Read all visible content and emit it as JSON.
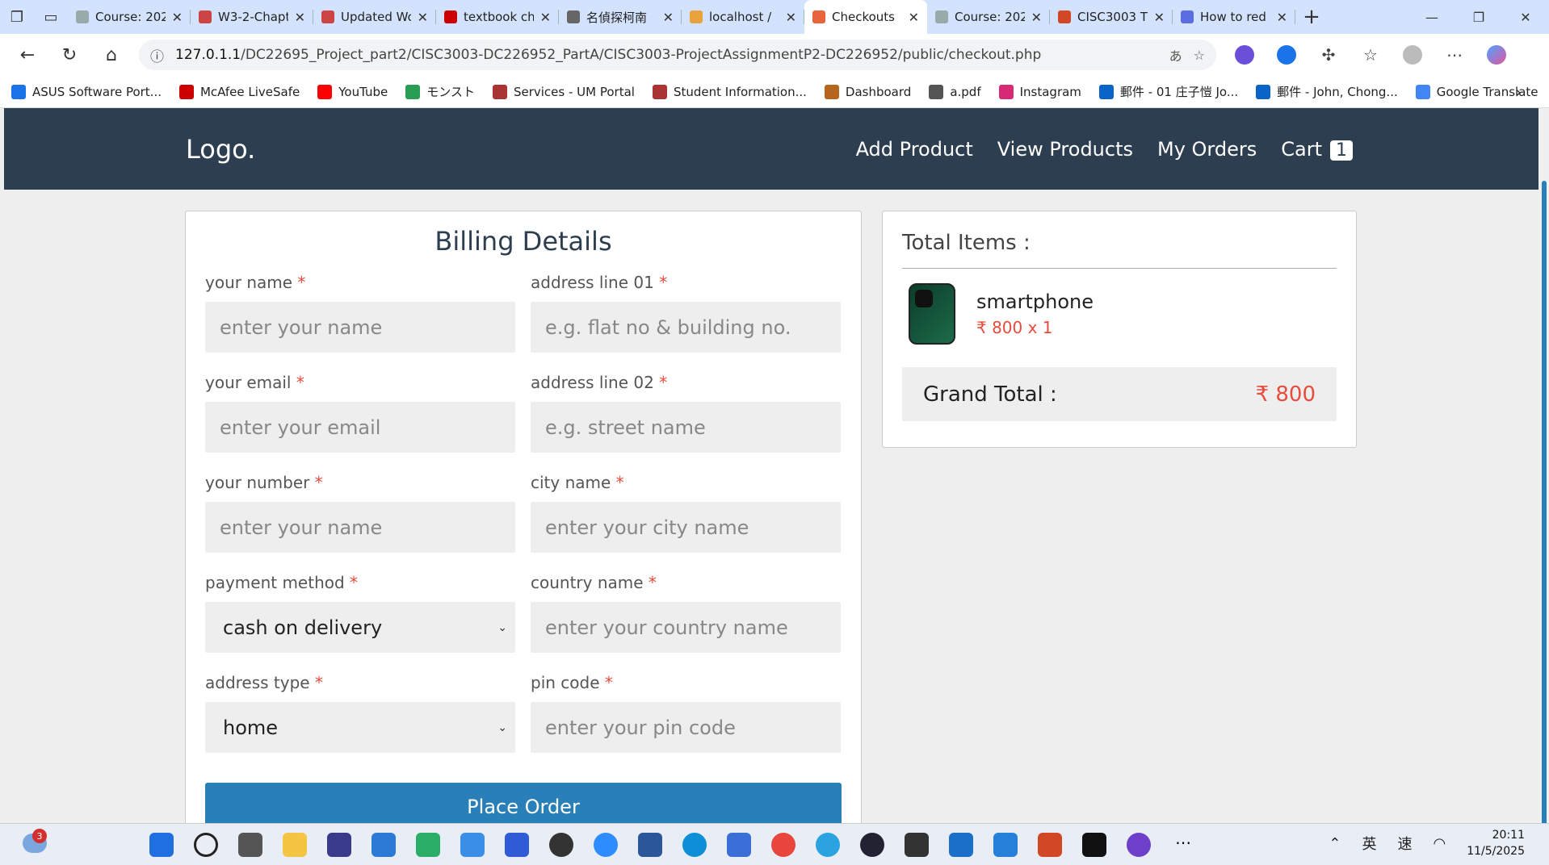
{
  "browser": {
    "tabs": [
      {
        "title": "Course: 2025",
        "color": "#9aa"
      },
      {
        "title": "W3-2-Chapter",
        "color": "#c44"
      },
      {
        "title": "Updated Wo",
        "color": "#c44"
      },
      {
        "title": "textbook ch",
        "color": "#c00"
      },
      {
        "title": "名偵探柯南",
        "color": "#666"
      },
      {
        "title": "localhost /",
        "color": "#e8a33d"
      },
      {
        "title": "Checkouts",
        "color": "#e8643d",
        "active": true
      },
      {
        "title": "Course: 2025",
        "color": "#9aa"
      },
      {
        "title": "CISC3003 T",
        "color": "#d24726"
      },
      {
        "title": "How to red",
        "color": "#5b6ee1"
      }
    ],
    "url_host": "127.0.1.1",
    "url_path": "/DC22695_Project_part2/CISC3003-DC226952_PartA/CISC3003-ProjectAssignmentP2-DC226952/public/checkout.php",
    "bookmarks": [
      {
        "label": "ASUS Software Port...",
        "color": "#1a73e8"
      },
      {
        "label": "McAfee LiveSafe",
        "color": "#c00"
      },
      {
        "label": "YouTube",
        "color": "#f00"
      },
      {
        "label": "モンスト",
        "color": "#2a9d55"
      },
      {
        "label": "Services - UM Portal",
        "color": "#a33"
      },
      {
        "label": "Student Information...",
        "color": "#a33"
      },
      {
        "label": "Dashboard",
        "color": "#b5651d"
      },
      {
        "label": "a.pdf",
        "color": "#555"
      },
      {
        "label": "Instagram",
        "color": "#d62976"
      },
      {
        "label": "郵件 - 01 庄子愷 Jo...",
        "color": "#0a64c8"
      },
      {
        "label": "郵件 - John, Chong...",
        "color": "#0a64c8"
      },
      {
        "label": "Google Translate",
        "color": "#4285f4"
      }
    ]
  },
  "header": {
    "logo": "Logo.",
    "nav": [
      "Add Product",
      "View Products",
      "My Orders"
    ],
    "cart_label": "Cart",
    "cart_count": "1"
  },
  "billing": {
    "title": "Billing Details",
    "fields": [
      {
        "label": "your name",
        "placeholder": "enter your name"
      },
      {
        "label": "address line 01",
        "placeholder": "e.g. flat no & building no."
      },
      {
        "label": "your email",
        "placeholder": "enter your email"
      },
      {
        "label": "address line 02",
        "placeholder": "e.g. street name"
      },
      {
        "label": "your number",
        "placeholder": "enter your name"
      },
      {
        "label": "city name",
        "placeholder": "enter your city name"
      },
      {
        "label": "payment method",
        "value": "cash on delivery"
      },
      {
        "label": "country name",
        "placeholder": "enter your country name"
      },
      {
        "label": "address type",
        "value": "home"
      },
      {
        "label": "pin code",
        "placeholder": "enter your pin code"
      }
    ],
    "required_mark": "*",
    "submit_label": "Place Order"
  },
  "summary": {
    "title": "Total Items :",
    "item_name": "smartphone",
    "item_price": "₹ 800 x 1",
    "grand_label": "Grand Total :",
    "grand_value": "₹ 800"
  },
  "taskbar": {
    "weather_badge": "3",
    "ime1": "英",
    "ime2": "速",
    "time": "20:11",
    "date": "11/5/2025"
  }
}
